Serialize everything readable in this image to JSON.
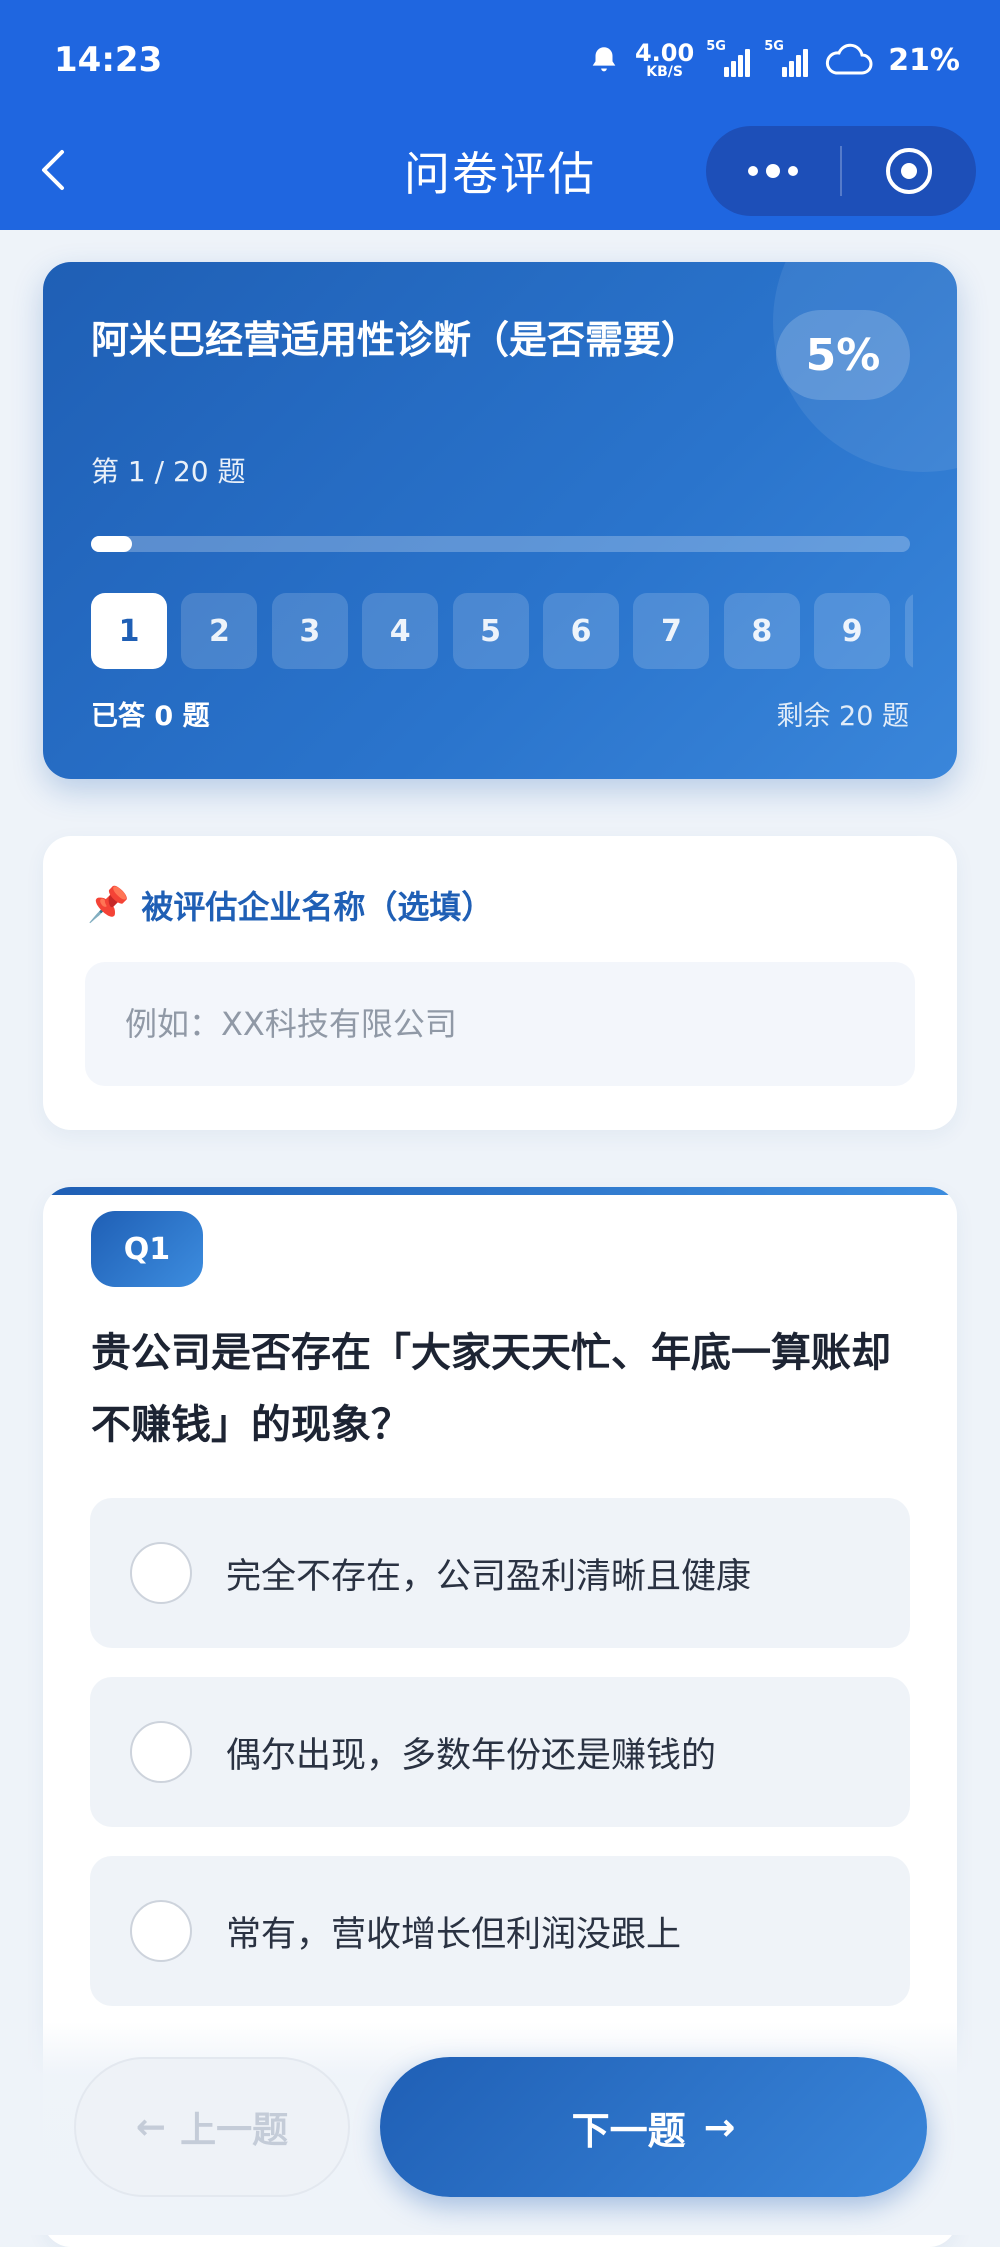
{
  "status_bar": {
    "time": "14:23",
    "net_speed_value": "4.00",
    "net_speed_unit": "KB/S",
    "signal_1_label": "5G",
    "signal_2_label": "5G",
    "battery": "21%"
  },
  "nav": {
    "title": "问卷评估"
  },
  "progress": {
    "survey_title": "阿米巴经营适用性诊断（是否需要）",
    "percent": "5%",
    "percent_value": 0.05,
    "page_indicator": "第 1 / 20 题",
    "questions": [
      "1",
      "2",
      "3",
      "4",
      "5",
      "6",
      "7",
      "8",
      "9"
    ],
    "active_index": 0,
    "answered": "已答 0 题",
    "remaining": "剩余 20 题"
  },
  "company": {
    "pin_icon": "📌",
    "label": "被评估企业名称（选填）",
    "placeholder": "例如：XX科技有限公司"
  },
  "question": {
    "badge": "Q1",
    "text": "贵公司是否存在「大家天天忙、年底一算账却不赚钱」的现象？",
    "options": [
      "完全不存在，公司盈利清晰且健康",
      "偶尔出现，多数年份还是赚钱的",
      "常有，营收增长但利润没跟上"
    ]
  },
  "footer": {
    "prev_label": "上一题",
    "prev_arrow": "←",
    "next_label": "下一题",
    "next_arrow": "→"
  },
  "colors": {
    "brand_blue": "#1f66e0",
    "card_blue": "#1f5fb5"
  }
}
